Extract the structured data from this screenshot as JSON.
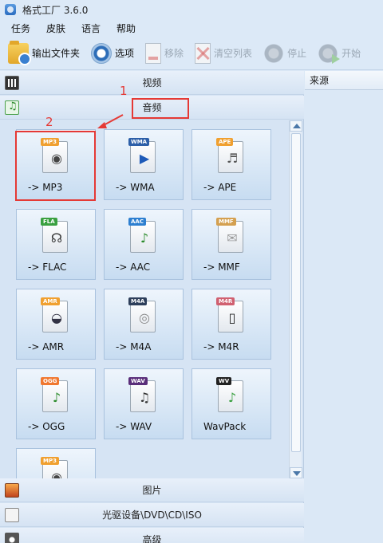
{
  "window": {
    "title": "格式工厂 3.6.0"
  },
  "menu": [
    "任务",
    "皮肤",
    "语言",
    "帮助"
  ],
  "toolbar": {
    "output_folder": "输出文件夹",
    "options": "选项",
    "remove": "移除",
    "clear_list": "清空列表",
    "stop": "停止",
    "start": "开始"
  },
  "categories": {
    "video": "视频",
    "audio": "音频",
    "picture": "图片",
    "disc": "光驱设备\\DVD\\CD\\ISO",
    "advanced": "高级"
  },
  "formats": [
    {
      "label": "-> MP3",
      "badge": "MP3",
      "badge_color": "#f0a030",
      "glyph": "speaker"
    },
    {
      "label": "-> WMA",
      "badge": "WMA",
      "badge_color": "#2d5fa8",
      "glyph": "play"
    },
    {
      "label": "-> APE",
      "badge": "APE",
      "badge_color": "#f0a030",
      "glyph": "headphones"
    },
    {
      "label": "-> FLAC",
      "badge": "FLA",
      "badge_color": "#3aa040",
      "glyph": "headset"
    },
    {
      "label": "-> AAC",
      "badge": "AAC",
      "badge_color": "#2d7fd0",
      "glyph": "note"
    },
    {
      "label": "-> MMF",
      "badge": "MMF",
      "badge_color": "#d4a050",
      "glyph": "mail"
    },
    {
      "label": "-> AMR",
      "badge": "AMR",
      "badge_color": "#f0a030",
      "glyph": "disc"
    },
    {
      "label": "-> M4A",
      "badge": "M4A",
      "badge_color": "#2d3e5a",
      "glyph": "cd"
    },
    {
      "label": "-> M4R",
      "badge": "M4R",
      "badge_color": "#d06070",
      "glyph": "phone"
    },
    {
      "label": "-> OGG",
      "badge": "OGG",
      "badge_color": "#f07830",
      "glyph": "note"
    },
    {
      "label": "-> WAV",
      "badge": "WAV",
      "badge_color": "#5a2e7a",
      "glyph": "notes"
    },
    {
      "label": "WavPack",
      "badge": "WV",
      "badge_color": "#222222",
      "glyph": "note-green"
    },
    {
      "label": "",
      "badge": "MP3",
      "badge_color": "#f0a030",
      "glyph": "speaker"
    }
  ],
  "right_panel": {
    "header": "来源"
  },
  "annotations": {
    "one": "1",
    "two": "2"
  },
  "colors": {
    "annotation": "#e53935",
    "panel_bg": "#d6e4f4"
  }
}
